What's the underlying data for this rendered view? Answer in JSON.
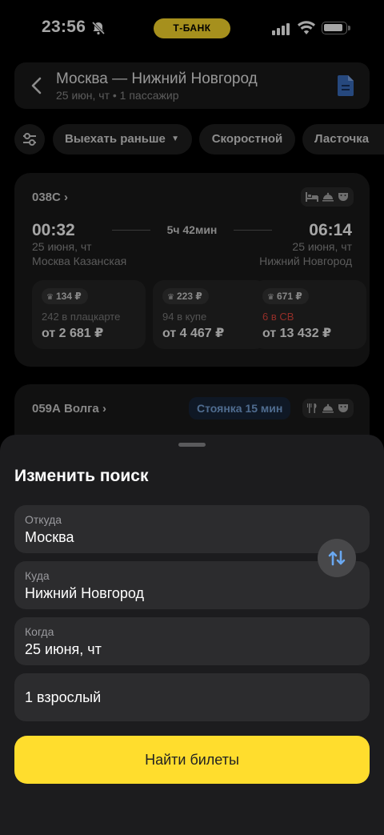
{
  "status_bar": {
    "time": "23:56",
    "bank_label": "Т-БАНК"
  },
  "header": {
    "route": "Москва — Нижний Новгород",
    "subtitle": "25 июн, чт • 1 пассажир"
  },
  "filters": {
    "earlier": "Выехать раньше",
    "fast": "Скоростной",
    "swallow": "Ласточка"
  },
  "train1": {
    "number": "038С",
    "departure_time": "00:32",
    "arrival_time": "06:14",
    "duration": "5ч 42мин",
    "departure_date": "25 июня, чт",
    "arrival_date": "25 июня, чт",
    "departure_station": "Москва Казанская",
    "arrival_station": "Нижний Новгород",
    "fares": [
      {
        "bonus": "134 ₽",
        "availability": "242 в плацкарте",
        "price": "от 2 681 ₽"
      },
      {
        "bonus": "223 ₽",
        "availability": "94 в купе",
        "price": "от 4 467 ₽"
      },
      {
        "bonus": "671 ₽",
        "availability": "6 в СВ",
        "price": "от 13 432 ₽"
      }
    ]
  },
  "train2": {
    "number": "059А Волга",
    "stop": "Стоянка 15 мин"
  },
  "sheet": {
    "title": "Изменить поиск",
    "from_label": "Откуда",
    "from_value": "Москва",
    "to_label": "Куда",
    "to_value": "Нижний Новгород",
    "when_label": "Когда",
    "when_value": "25 июня, чт",
    "passengers": "1 взрослый",
    "search_button": "Найти билеты"
  },
  "colors": {
    "accent_yellow": "#ffdd2d",
    "availability_low": "#e0473e",
    "swap_arrow_blue": "#6aa8f0"
  }
}
